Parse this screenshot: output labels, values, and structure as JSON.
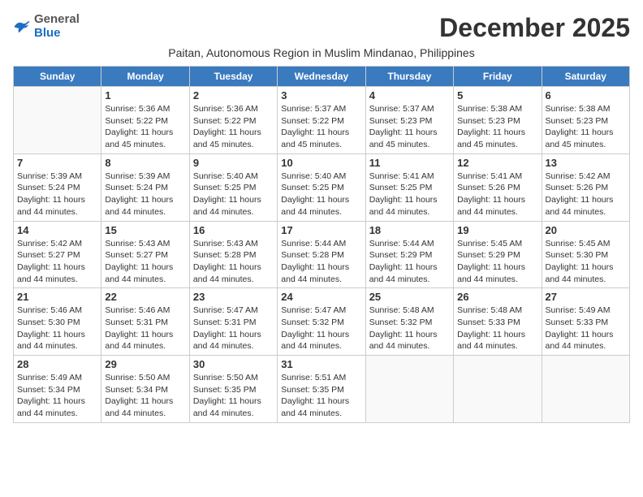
{
  "header": {
    "logo_general": "General",
    "logo_blue": "Blue",
    "month_title": "December 2025",
    "subtitle": "Paitan, Autonomous Region in Muslim Mindanao, Philippines"
  },
  "calendar": {
    "headers": [
      "Sunday",
      "Monday",
      "Tuesday",
      "Wednesday",
      "Thursday",
      "Friday",
      "Saturday"
    ],
    "weeks": [
      [
        {
          "day": "",
          "sunrise": "",
          "sunset": "",
          "daylight": ""
        },
        {
          "day": "1",
          "sunrise": "Sunrise: 5:36 AM",
          "sunset": "Sunset: 5:22 PM",
          "daylight": "Daylight: 11 hours and 45 minutes."
        },
        {
          "day": "2",
          "sunrise": "Sunrise: 5:36 AM",
          "sunset": "Sunset: 5:22 PM",
          "daylight": "Daylight: 11 hours and 45 minutes."
        },
        {
          "day": "3",
          "sunrise": "Sunrise: 5:37 AM",
          "sunset": "Sunset: 5:22 PM",
          "daylight": "Daylight: 11 hours and 45 minutes."
        },
        {
          "day": "4",
          "sunrise": "Sunrise: 5:37 AM",
          "sunset": "Sunset: 5:23 PM",
          "daylight": "Daylight: 11 hours and 45 minutes."
        },
        {
          "day": "5",
          "sunrise": "Sunrise: 5:38 AM",
          "sunset": "Sunset: 5:23 PM",
          "daylight": "Daylight: 11 hours and 45 minutes."
        },
        {
          "day": "6",
          "sunrise": "Sunrise: 5:38 AM",
          "sunset": "Sunset: 5:23 PM",
          "daylight": "Daylight: 11 hours and 45 minutes."
        }
      ],
      [
        {
          "day": "7",
          "sunrise": "Sunrise: 5:39 AM",
          "sunset": "Sunset: 5:24 PM",
          "daylight": "Daylight: 11 hours and 44 minutes."
        },
        {
          "day": "8",
          "sunrise": "Sunrise: 5:39 AM",
          "sunset": "Sunset: 5:24 PM",
          "daylight": "Daylight: 11 hours and 44 minutes."
        },
        {
          "day": "9",
          "sunrise": "Sunrise: 5:40 AM",
          "sunset": "Sunset: 5:25 PM",
          "daylight": "Daylight: 11 hours and 44 minutes."
        },
        {
          "day": "10",
          "sunrise": "Sunrise: 5:40 AM",
          "sunset": "Sunset: 5:25 PM",
          "daylight": "Daylight: 11 hours and 44 minutes."
        },
        {
          "day": "11",
          "sunrise": "Sunrise: 5:41 AM",
          "sunset": "Sunset: 5:25 PM",
          "daylight": "Daylight: 11 hours and 44 minutes."
        },
        {
          "day": "12",
          "sunrise": "Sunrise: 5:41 AM",
          "sunset": "Sunset: 5:26 PM",
          "daylight": "Daylight: 11 hours and 44 minutes."
        },
        {
          "day": "13",
          "sunrise": "Sunrise: 5:42 AM",
          "sunset": "Sunset: 5:26 PM",
          "daylight": "Daylight: 11 hours and 44 minutes."
        }
      ],
      [
        {
          "day": "14",
          "sunrise": "Sunrise: 5:42 AM",
          "sunset": "Sunset: 5:27 PM",
          "daylight": "Daylight: 11 hours and 44 minutes."
        },
        {
          "day": "15",
          "sunrise": "Sunrise: 5:43 AM",
          "sunset": "Sunset: 5:27 PM",
          "daylight": "Daylight: 11 hours and 44 minutes."
        },
        {
          "day": "16",
          "sunrise": "Sunrise: 5:43 AM",
          "sunset": "Sunset: 5:28 PM",
          "daylight": "Daylight: 11 hours and 44 minutes."
        },
        {
          "day": "17",
          "sunrise": "Sunrise: 5:44 AM",
          "sunset": "Sunset: 5:28 PM",
          "daylight": "Daylight: 11 hours and 44 minutes."
        },
        {
          "day": "18",
          "sunrise": "Sunrise: 5:44 AM",
          "sunset": "Sunset: 5:29 PM",
          "daylight": "Daylight: 11 hours and 44 minutes."
        },
        {
          "day": "19",
          "sunrise": "Sunrise: 5:45 AM",
          "sunset": "Sunset: 5:29 PM",
          "daylight": "Daylight: 11 hours and 44 minutes."
        },
        {
          "day": "20",
          "sunrise": "Sunrise: 5:45 AM",
          "sunset": "Sunset: 5:30 PM",
          "daylight": "Daylight: 11 hours and 44 minutes."
        }
      ],
      [
        {
          "day": "21",
          "sunrise": "Sunrise: 5:46 AM",
          "sunset": "Sunset: 5:30 PM",
          "daylight": "Daylight: 11 hours and 44 minutes."
        },
        {
          "day": "22",
          "sunrise": "Sunrise: 5:46 AM",
          "sunset": "Sunset: 5:31 PM",
          "daylight": "Daylight: 11 hours and 44 minutes."
        },
        {
          "day": "23",
          "sunrise": "Sunrise: 5:47 AM",
          "sunset": "Sunset: 5:31 PM",
          "daylight": "Daylight: 11 hours and 44 minutes."
        },
        {
          "day": "24",
          "sunrise": "Sunrise: 5:47 AM",
          "sunset": "Sunset: 5:32 PM",
          "daylight": "Daylight: 11 hours and 44 minutes."
        },
        {
          "day": "25",
          "sunrise": "Sunrise: 5:48 AM",
          "sunset": "Sunset: 5:32 PM",
          "daylight": "Daylight: 11 hours and 44 minutes."
        },
        {
          "day": "26",
          "sunrise": "Sunrise: 5:48 AM",
          "sunset": "Sunset: 5:33 PM",
          "daylight": "Daylight: 11 hours and 44 minutes."
        },
        {
          "day": "27",
          "sunrise": "Sunrise: 5:49 AM",
          "sunset": "Sunset: 5:33 PM",
          "daylight": "Daylight: 11 hours and 44 minutes."
        }
      ],
      [
        {
          "day": "28",
          "sunrise": "Sunrise: 5:49 AM",
          "sunset": "Sunset: 5:34 PM",
          "daylight": "Daylight: 11 hours and 44 minutes."
        },
        {
          "day": "29",
          "sunrise": "Sunrise: 5:50 AM",
          "sunset": "Sunset: 5:34 PM",
          "daylight": "Daylight: 11 hours and 44 minutes."
        },
        {
          "day": "30",
          "sunrise": "Sunrise: 5:50 AM",
          "sunset": "Sunset: 5:35 PM",
          "daylight": "Daylight: 11 hours and 44 minutes."
        },
        {
          "day": "31",
          "sunrise": "Sunrise: 5:51 AM",
          "sunset": "Sunset: 5:35 PM",
          "daylight": "Daylight: 11 hours and 44 minutes."
        },
        {
          "day": "",
          "sunrise": "",
          "sunset": "",
          "daylight": ""
        },
        {
          "day": "",
          "sunrise": "",
          "sunset": "",
          "daylight": ""
        },
        {
          "day": "",
          "sunrise": "",
          "sunset": "",
          "daylight": ""
        }
      ]
    ]
  }
}
